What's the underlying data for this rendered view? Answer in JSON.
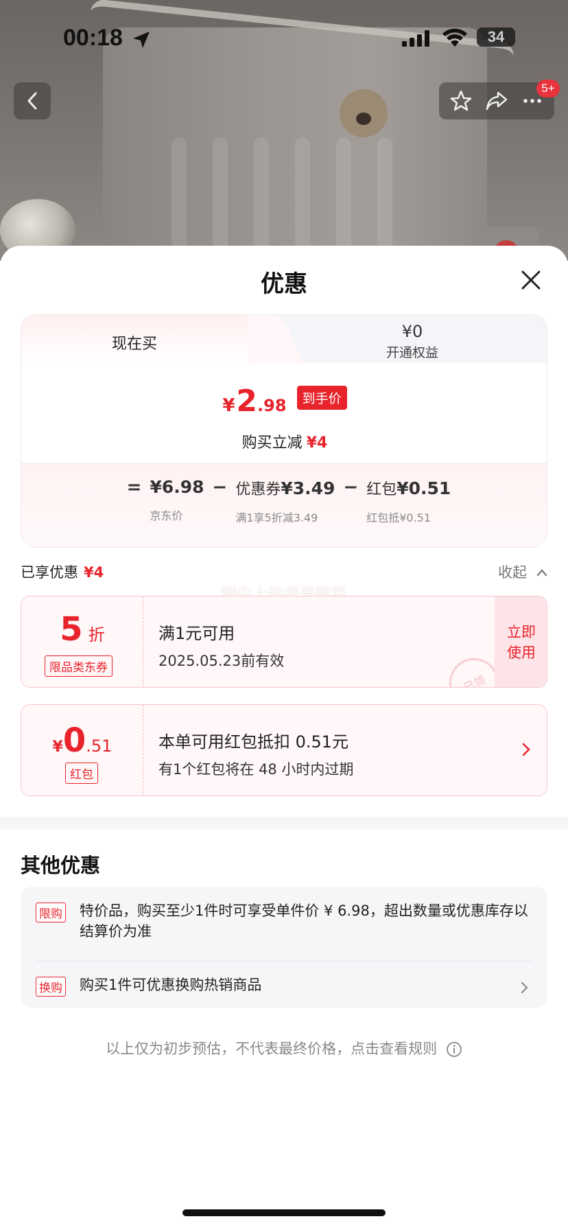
{
  "status_bar": {
    "time": "00:18",
    "battery": "34"
  },
  "nav": {
    "badge": "5+"
  },
  "sheet": {
    "title": "优惠",
    "tabs": {
      "current_label": "现在买",
      "right_price": "¥0",
      "right_label": "开通权益"
    },
    "final_price": {
      "currency": "¥",
      "integer": "2",
      "decimal": ".98",
      "tag": "到手价"
    },
    "reduce": {
      "label": "购买立减",
      "amount": "¥4"
    },
    "formula": {
      "equals": "=",
      "minus": "−",
      "items": [
        {
          "label": "",
          "value": "¥6.98",
          "sub": "京东价"
        },
        {
          "label": "优惠券",
          "value": "¥3.49",
          "sub": "满1享5折减3.49"
        },
        {
          "label": "红包",
          "value": "¥0.51",
          "sub": "红包抵¥0.51"
        }
      ]
    },
    "enjoyed": {
      "label": "已享优惠",
      "amount": "¥4"
    },
    "collapse_label": "收起",
    "watermark": "脚尖上的老麦歐菜",
    "coupon1": {
      "value": "5",
      "unit": "折",
      "type_label": "限品类东券",
      "title": "满1元可用",
      "validity": "2025.05.23前有效",
      "button": "立即使用",
      "stamp": "已领"
    },
    "coupon2": {
      "currency": "¥",
      "integer": "0",
      "decimal": ".51",
      "type_label": "红包",
      "title": "本单可用红包抵扣 0.51元",
      "subtitle": "有1个红包将在 48 小时内过期"
    },
    "other": {
      "title": "其他优惠",
      "rows": [
        {
          "tag": "限购",
          "text": "特价品，购买至少1件时可享受单件价 ¥ 6.98，超出数量或优惠库存以结算价为准"
        },
        {
          "tag": "换购",
          "text": "购买1件可优惠换购热销商品"
        }
      ]
    },
    "footnote": "以上仅为初步预估，不代表最终价格，点击查看规则"
  },
  "colors": {
    "accent": "#e8232c",
    "coupon_bg": "#fff7f8"
  }
}
